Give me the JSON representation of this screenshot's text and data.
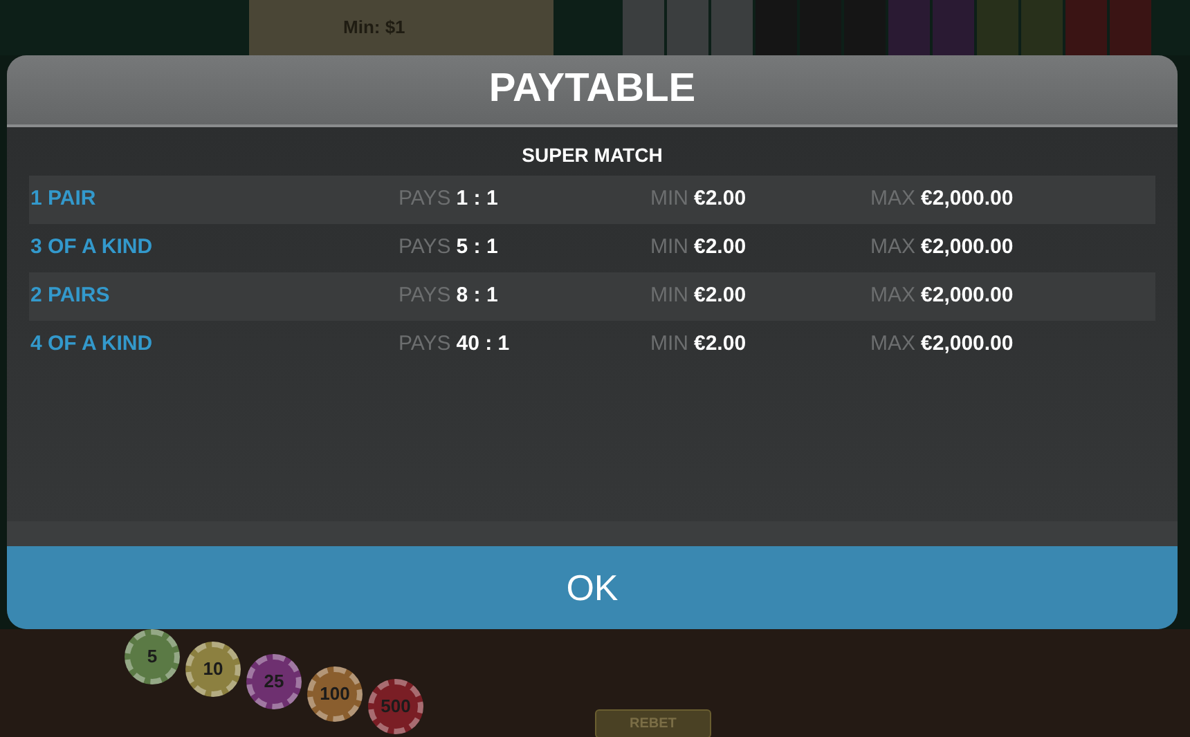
{
  "top_bar": {
    "min_label": "Min: $1"
  },
  "dialog": {
    "title": "PAYTABLE",
    "section_title": "SUPER MATCH",
    "rows": [
      {
        "hand": "1 PAIR",
        "pays_label": "PAYS",
        "pays": "1 : 1",
        "min_label": "MIN",
        "min": "€2.00",
        "max_label": "MAX",
        "max": "€2,000.00"
      },
      {
        "hand": "3 OF A KIND",
        "pays_label": "PAYS",
        "pays": "5 : 1",
        "min_label": "MIN",
        "min": "€2.00",
        "max_label": "MAX",
        "max": "€2,000.00"
      },
      {
        "hand": "2 PAIRS",
        "pays_label": "PAYS",
        "pays": "8 : 1",
        "min_label": "MIN",
        "min": "€2.00",
        "max_label": "MAX",
        "max": "€2,000.00"
      },
      {
        "hand": "4 OF A KIND",
        "pays_label": "PAYS",
        "pays": "40 : 1",
        "min_label": "MIN",
        "min": "€2.00",
        "max_label": "MAX",
        "max": "€2,000.00"
      }
    ],
    "ok_button": "OK"
  },
  "table": {
    "chips": [
      {
        "value": "5",
        "color": "#5b7a45"
      },
      {
        "value": "10",
        "color": "#8c8040"
      },
      {
        "value": "25",
        "color": "#6e3070"
      },
      {
        "value": "100",
        "color": "#8a5e2e"
      },
      {
        "value": "500",
        "color": "#7a1e25"
      }
    ],
    "rebet": "REBET"
  }
}
